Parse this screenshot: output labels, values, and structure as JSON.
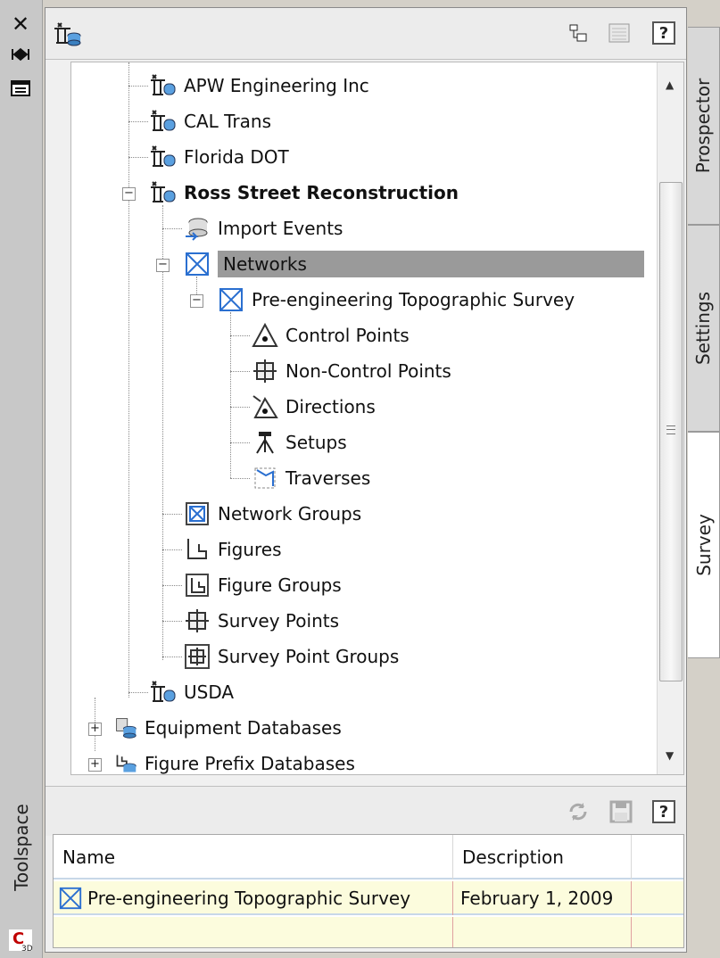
{
  "side": {
    "close_icon": "close-icon",
    "autohide_icon": "autohide-icon",
    "properties_icon": "properties-icon",
    "title": "Toolspace"
  },
  "tabs": [
    {
      "label": "Prospector",
      "active": false
    },
    {
      "label": "Settings",
      "active": false
    },
    {
      "label": "Survey",
      "active": true
    }
  ],
  "toolbar": {
    "help_label": "?"
  },
  "tree": {
    "nodes": [
      {
        "label": "APW Engineering Inc",
        "icon": "survey-database-icon"
      },
      {
        "label": "CAL Trans",
        "icon": "survey-database-icon"
      },
      {
        "label": "Florida DOT",
        "icon": "survey-database-icon"
      },
      {
        "label": "Ross Street Reconstruction",
        "icon": "survey-database-icon",
        "expanded": true,
        "bold": true
      },
      {
        "label": "Import Events",
        "icon": "import-events-icon"
      },
      {
        "label": "Networks",
        "icon": "network-icon",
        "expanded": true,
        "selected": true
      },
      {
        "label": "Pre-engineering Topographic Survey",
        "icon": "network-icon",
        "expanded": true
      },
      {
        "label": "Control Points",
        "icon": "control-point-icon"
      },
      {
        "label": "Non-Control Points",
        "icon": "non-control-point-icon"
      },
      {
        "label": "Directions",
        "icon": "direction-icon"
      },
      {
        "label": "Setups",
        "icon": "setup-icon"
      },
      {
        "label": "Traverses",
        "icon": "traverse-icon"
      },
      {
        "label": "Network Groups",
        "icon": "network-group-icon"
      },
      {
        "label": "Figures",
        "icon": "figure-icon"
      },
      {
        "label": "Figure Groups",
        "icon": "figure-group-icon"
      },
      {
        "label": "Survey Points",
        "icon": "survey-point-icon"
      },
      {
        "label": "Survey Point Groups",
        "icon": "survey-point-group-icon"
      },
      {
        "label": "USDA",
        "icon": "survey-database-icon"
      },
      {
        "label": "Equipment Databases",
        "icon": "equipment-database-icon",
        "expanded": false
      },
      {
        "label": "Figure Prefix Databases",
        "icon": "figure-prefix-database-icon",
        "expanded": false
      }
    ]
  },
  "bottom": {
    "help_label": "?",
    "columns": [
      "Name",
      "Description"
    ],
    "rows": [
      {
        "name": "Pre-engineering Topographic Survey",
        "description": "February 1, 2009"
      }
    ]
  }
}
